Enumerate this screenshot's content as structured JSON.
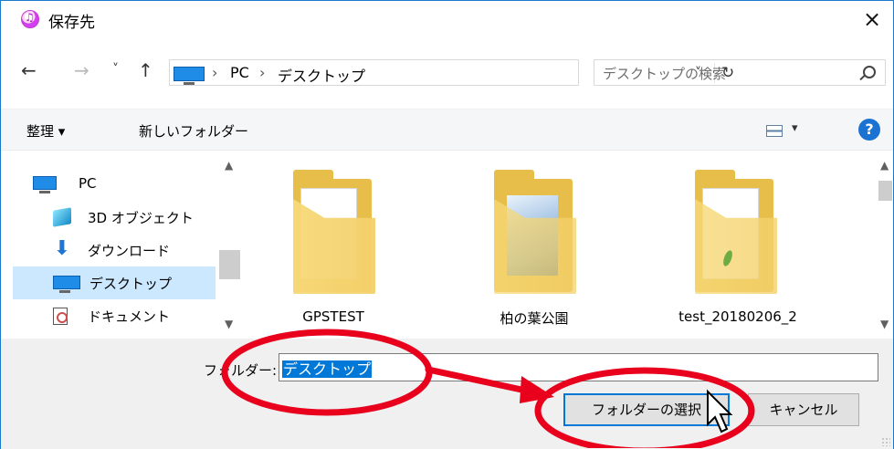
{
  "titlebar": {
    "title": "保存先",
    "close_glyph": "×"
  },
  "navigation": {
    "back_glyph": "←",
    "forward_glyph": "→",
    "recent_glyph": "˅",
    "up_glyph": "↑",
    "breadcrumb": [
      "PC",
      "デスクトップ"
    ],
    "separator": "›",
    "dropdown_glyph": "˅",
    "refresh_glyph": "↻",
    "search_placeholder": "デスクトップの検索"
  },
  "commandbar": {
    "organize_label": "整理 ▾",
    "new_folder_label": "新しいフォルダー",
    "view_dropdown_glyph": "▾",
    "help_glyph": "?"
  },
  "sidebar": {
    "items": [
      {
        "label": "PC",
        "icon": "pc-icon"
      },
      {
        "label": "3D オブジェクト",
        "icon": "cube-icon"
      },
      {
        "label": "ダウンロード",
        "icon": "download-icon"
      },
      {
        "label": "デスクトップ",
        "icon": "desktop-icon",
        "selected": true
      },
      {
        "label": "ドキュメント",
        "icon": "document-icon"
      }
    ]
  },
  "folders": [
    {
      "name": "GPSTEST"
    },
    {
      "name": "柏の葉公園"
    },
    {
      "name": "test_20180206_2"
    }
  ],
  "footer": {
    "folder_label": "フォルダー:",
    "folder_value": "デスクトップ",
    "select_button": "フォルダーの選択",
    "cancel_button": "キャンセル"
  },
  "colors": {
    "accent": "#0078d7",
    "highlight_annotation": "#e8001c",
    "selection": "#cce8ff"
  }
}
